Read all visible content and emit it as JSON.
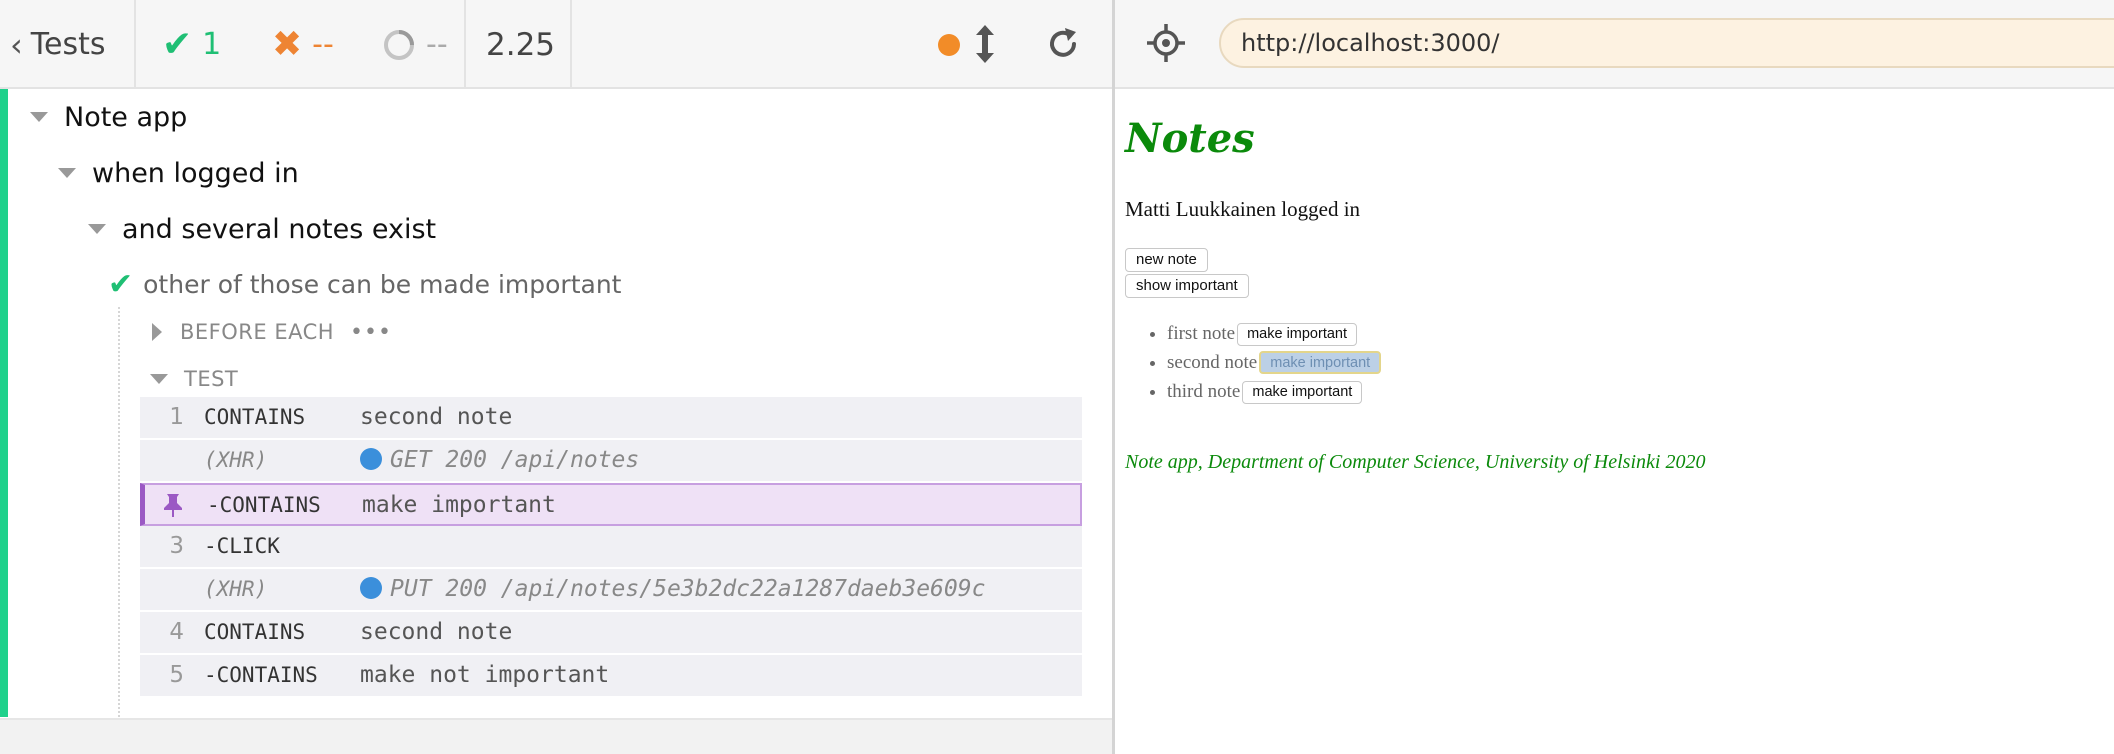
{
  "reporter": {
    "header": {
      "tests_label": "Tests",
      "passed": "1",
      "failed": "--",
      "pending": "--",
      "duration": "2.25",
      "status_color": "#f28c28"
    },
    "suites": [
      {
        "title": "Note app"
      },
      {
        "title": "when logged in"
      },
      {
        "title": "and several notes exist"
      }
    ],
    "test": {
      "title": "other of those can be made important",
      "state": "passed"
    },
    "hooks": {
      "before_each": "BEFORE EACH",
      "before_each_more": "•••",
      "test": "TEST"
    },
    "commands": [
      {
        "num": "1",
        "name": "CONTAINS",
        "message": "second note"
      },
      {
        "num": "",
        "name": "(XHR)",
        "message": "GET 200 /api/notes",
        "xhr": true
      },
      {
        "num": "",
        "name": "-CONTAINS",
        "message": "make important",
        "pinned": true
      },
      {
        "num": "3",
        "name": "-CLICK",
        "message": ""
      },
      {
        "num": "",
        "name": "(XHR)",
        "message": "PUT 200 /api/notes/5e3b2dc22a1287daeb3e609c",
        "xhr": true
      },
      {
        "num": "4",
        "name": "CONTAINS",
        "message": "second note"
      },
      {
        "num": "5",
        "name": "-CONTAINS",
        "message": "make not important"
      }
    ]
  },
  "aut": {
    "url": "http://localhost:3000/",
    "app": {
      "title": "Notes",
      "logged_in": "Matti Luukkainen logged in",
      "new_note_button": "new note",
      "show_important_button": "show important",
      "notes": [
        {
          "content": "first note",
          "button": "make important",
          "highlighted": false
        },
        {
          "content": "second note",
          "button": "make important",
          "highlighted": true
        },
        {
          "content": "third note",
          "button": "make important",
          "highlighted": false
        }
      ],
      "footer": "Note app, Department of Computer Science, University of Helsinki 2020"
    }
  },
  "colors": {
    "passed": "#1fbf74",
    "failed": "#ee8433",
    "accent": "#1fd18b",
    "app_green": "#0b8a0b",
    "xhr_blue": "#3b8fdb",
    "pinned_purple": "#9b59c4"
  }
}
